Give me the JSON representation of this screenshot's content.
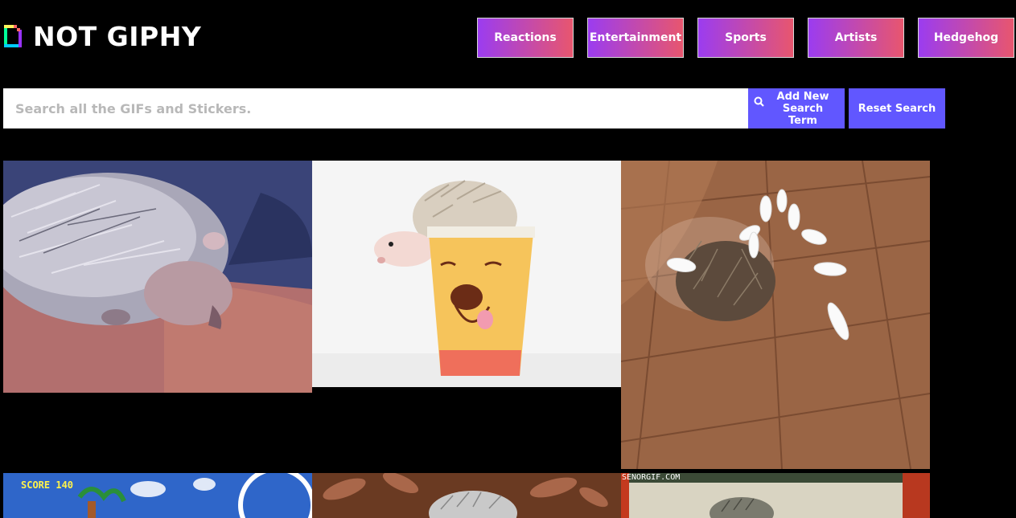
{
  "logo": {
    "text": "NOT GIPHY",
    "icon": "giphy-logo-icon"
  },
  "nav": {
    "items": [
      {
        "label": "Reactions"
      },
      {
        "label": "Entertainment"
      },
      {
        "label": "Sports"
      },
      {
        "label": "Artists"
      },
      {
        "label": "Hedgehog"
      }
    ]
  },
  "search": {
    "placeholder": "Search all the GIFs and Stickers.",
    "value": "",
    "add_label": "Add New Search Term",
    "add_icon": "search-icon",
    "reset_label": "Reset Search"
  },
  "gifs": {
    "items": [
      {
        "subject": "hedgehog-sniffing-carpet"
      },
      {
        "subject": "hedgehog-in-winnie-the-pooh-cup"
      },
      {
        "subject": "hedgehog-bowling-pins"
      },
      {
        "subject": "hedgehog-cartoon",
        "overlay_text": "SCORE 140"
      },
      {
        "subject": "hedgehog-in-leaves"
      },
      {
        "subject": "hedgehog-senorgif",
        "overlay_text": "SENORGIF.COM"
      }
    ]
  },
  "colors": {
    "background": "#000000",
    "button_gradient_start": "#9b3cf0",
    "button_gradient_end": "#e8566e",
    "action_button": "#6157ff"
  }
}
